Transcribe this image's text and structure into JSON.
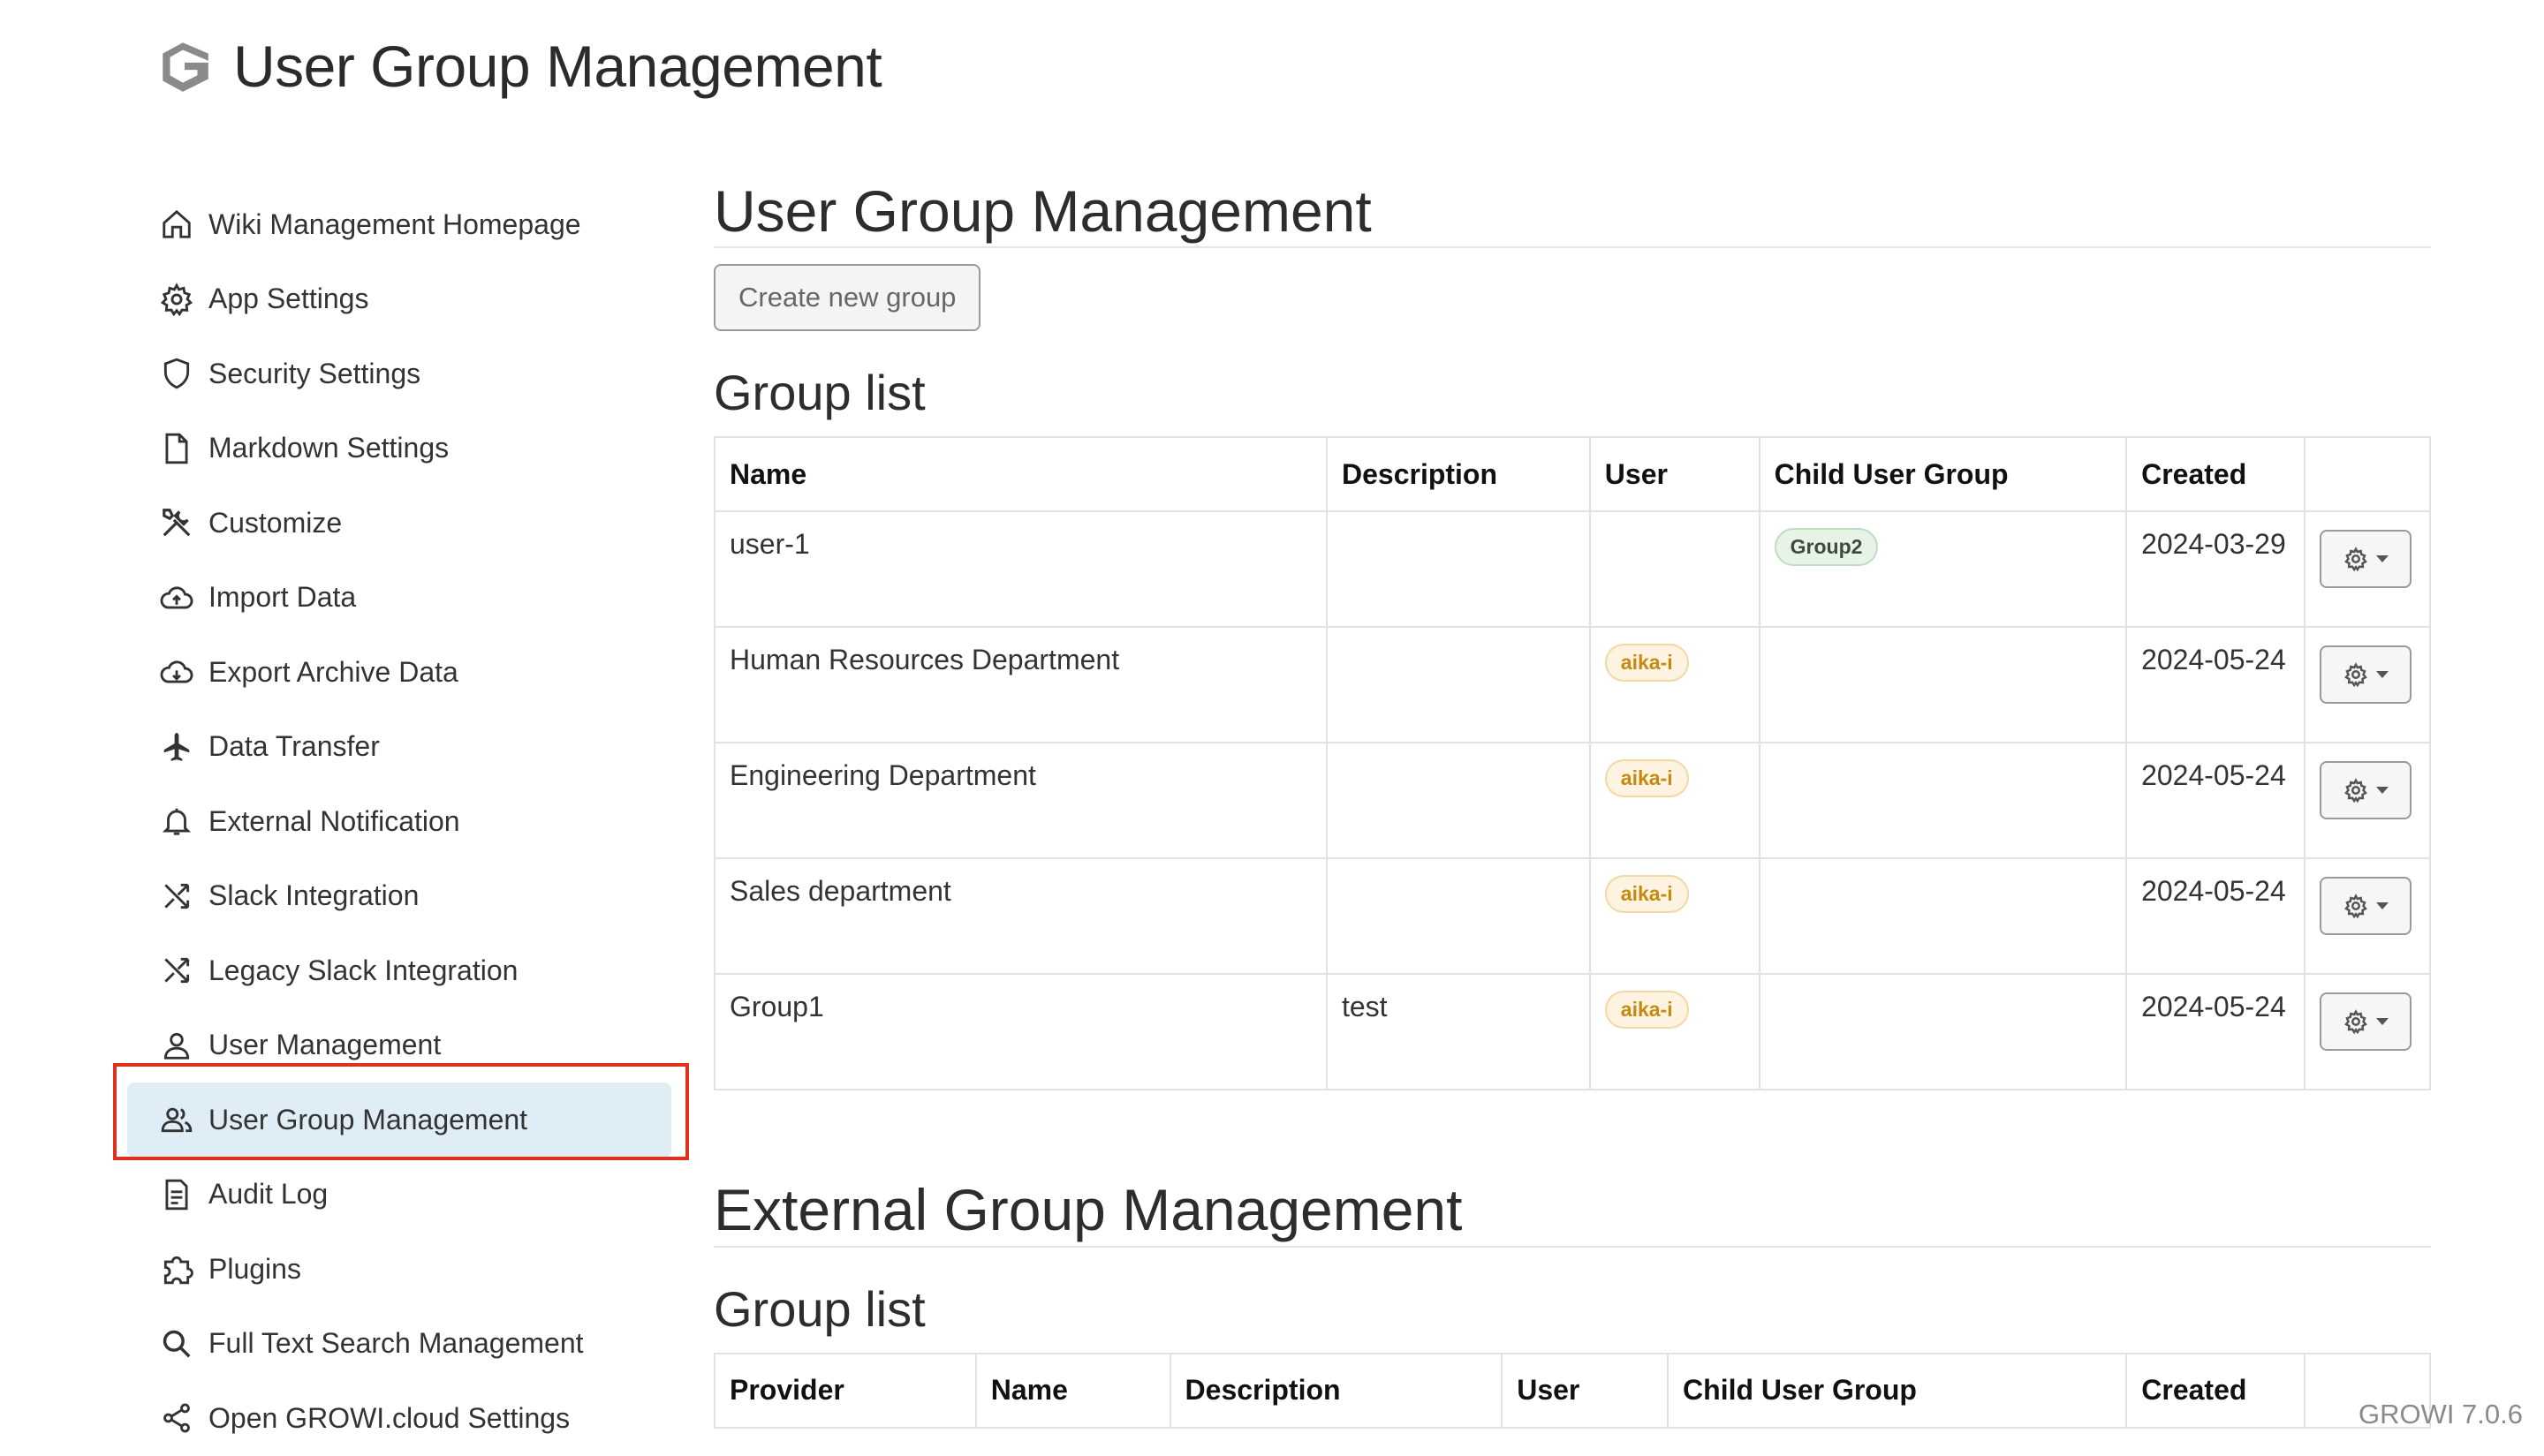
{
  "header": {
    "title": "User Group Management",
    "logo_icon": "growi-logo-icon"
  },
  "sidebar": {
    "items": [
      {
        "label": "Wiki Management Homepage",
        "icon": "home-icon"
      },
      {
        "label": "App Settings",
        "icon": "gear-icon"
      },
      {
        "label": "Security Settings",
        "icon": "shield-icon"
      },
      {
        "label": "Markdown Settings",
        "icon": "file-icon"
      },
      {
        "label": "Customize",
        "icon": "tools-icon"
      },
      {
        "label": "Import Data",
        "icon": "cloud-upload-icon"
      },
      {
        "label": "Export Archive Data",
        "icon": "cloud-download-icon"
      },
      {
        "label": "Data Transfer",
        "icon": "airplane-icon"
      },
      {
        "label": "External Notification",
        "icon": "bell-icon"
      },
      {
        "label": "Slack Integration",
        "icon": "shuffle-icon"
      },
      {
        "label": "Legacy Slack Integration",
        "icon": "shuffle-icon"
      },
      {
        "label": "User Management",
        "icon": "person-icon"
      },
      {
        "label": "User Group Management",
        "icon": "people-icon",
        "active": true
      },
      {
        "label": "Audit Log",
        "icon": "document-icon"
      },
      {
        "label": "Plugins",
        "icon": "puzzle-icon"
      },
      {
        "label": "Full Text Search Management",
        "icon": "search-icon"
      },
      {
        "label": "Open GROWI.cloud Settings",
        "icon": "share-icon"
      }
    ]
  },
  "main": {
    "title": "User Group Management",
    "create_button": "Create new group",
    "group_list_title": "Group list",
    "table": {
      "headers": [
        "Name",
        "Description",
        "User",
        "Child User Group",
        "Created",
        ""
      ],
      "rows": [
        {
          "name": "user-1",
          "description": "",
          "user": "",
          "child": "Group2",
          "created": "2024-03-29"
        },
        {
          "name": "Human Resources Department",
          "description": "",
          "user": "aika-i",
          "child": "",
          "created": "2024-05-24"
        },
        {
          "name": "Engineering Department",
          "description": "",
          "user": "aika-i",
          "child": "",
          "created": "2024-05-24"
        },
        {
          "name": "Sales department",
          "description": "",
          "user": "aika-i",
          "child": "",
          "created": "2024-05-24"
        },
        {
          "name": "Group1",
          "description": "test",
          "user": "aika-i",
          "child": "",
          "created": "2024-05-24"
        }
      ]
    },
    "external_title": "External Group Management",
    "external_group_list_title": "Group list",
    "external_table": {
      "headers": [
        "Provider",
        "Name",
        "Description",
        "User",
        "Child User Group",
        "Created",
        ""
      ]
    }
  },
  "footer": {
    "version": "GROWI 7.0.6"
  },
  "colors": {
    "active_bg": "#dfedf6",
    "highlight": "#e0311d",
    "user_badge": "#c58a12",
    "group_badge": "#e7f3e7"
  }
}
